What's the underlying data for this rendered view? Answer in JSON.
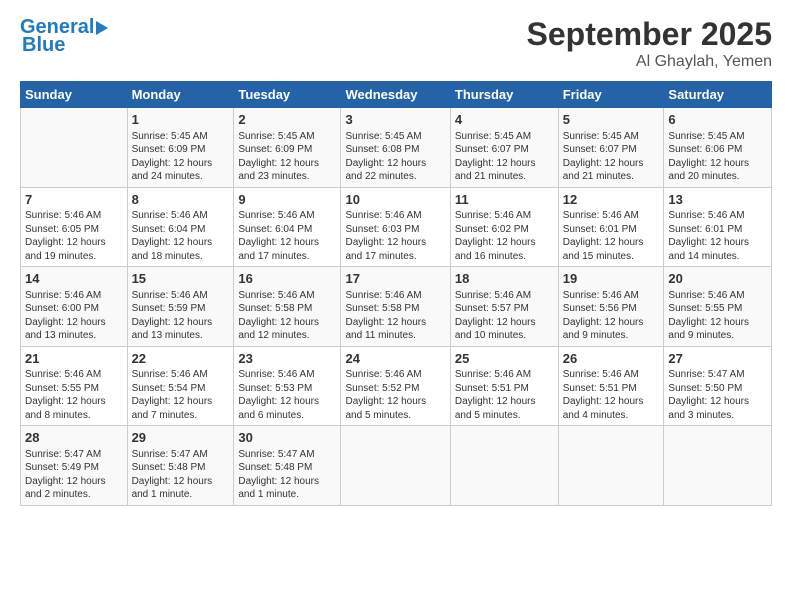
{
  "header": {
    "logo_line1": "General",
    "logo_line2": "Blue",
    "title": "September 2025",
    "location": "Al Ghaylah, Yemen"
  },
  "columns": [
    "Sunday",
    "Monday",
    "Tuesday",
    "Wednesday",
    "Thursday",
    "Friday",
    "Saturday"
  ],
  "weeks": [
    [
      {
        "day": "",
        "data": ""
      },
      {
        "day": "1",
        "data": "Sunrise: 5:45 AM\nSunset: 6:09 PM\nDaylight: 12 hours\nand 24 minutes."
      },
      {
        "day": "2",
        "data": "Sunrise: 5:45 AM\nSunset: 6:09 PM\nDaylight: 12 hours\nand 23 minutes."
      },
      {
        "day": "3",
        "data": "Sunrise: 5:45 AM\nSunset: 6:08 PM\nDaylight: 12 hours\nand 22 minutes."
      },
      {
        "day": "4",
        "data": "Sunrise: 5:45 AM\nSunset: 6:07 PM\nDaylight: 12 hours\nand 21 minutes."
      },
      {
        "day": "5",
        "data": "Sunrise: 5:45 AM\nSunset: 6:07 PM\nDaylight: 12 hours\nand 21 minutes."
      },
      {
        "day": "6",
        "data": "Sunrise: 5:45 AM\nSunset: 6:06 PM\nDaylight: 12 hours\nand 20 minutes."
      }
    ],
    [
      {
        "day": "7",
        "data": "Sunrise: 5:46 AM\nSunset: 6:05 PM\nDaylight: 12 hours\nand 19 minutes."
      },
      {
        "day": "8",
        "data": "Sunrise: 5:46 AM\nSunset: 6:04 PM\nDaylight: 12 hours\nand 18 minutes."
      },
      {
        "day": "9",
        "data": "Sunrise: 5:46 AM\nSunset: 6:04 PM\nDaylight: 12 hours\nand 17 minutes."
      },
      {
        "day": "10",
        "data": "Sunrise: 5:46 AM\nSunset: 6:03 PM\nDaylight: 12 hours\nand 17 minutes."
      },
      {
        "day": "11",
        "data": "Sunrise: 5:46 AM\nSunset: 6:02 PM\nDaylight: 12 hours\nand 16 minutes."
      },
      {
        "day": "12",
        "data": "Sunrise: 5:46 AM\nSunset: 6:01 PM\nDaylight: 12 hours\nand 15 minutes."
      },
      {
        "day": "13",
        "data": "Sunrise: 5:46 AM\nSunset: 6:01 PM\nDaylight: 12 hours\nand 14 minutes."
      }
    ],
    [
      {
        "day": "14",
        "data": "Sunrise: 5:46 AM\nSunset: 6:00 PM\nDaylight: 12 hours\nand 13 minutes."
      },
      {
        "day": "15",
        "data": "Sunrise: 5:46 AM\nSunset: 5:59 PM\nDaylight: 12 hours\nand 13 minutes."
      },
      {
        "day": "16",
        "data": "Sunrise: 5:46 AM\nSunset: 5:58 PM\nDaylight: 12 hours\nand 12 minutes."
      },
      {
        "day": "17",
        "data": "Sunrise: 5:46 AM\nSunset: 5:58 PM\nDaylight: 12 hours\nand 11 minutes."
      },
      {
        "day": "18",
        "data": "Sunrise: 5:46 AM\nSunset: 5:57 PM\nDaylight: 12 hours\nand 10 minutes."
      },
      {
        "day": "19",
        "data": "Sunrise: 5:46 AM\nSunset: 5:56 PM\nDaylight: 12 hours\nand 9 minutes."
      },
      {
        "day": "20",
        "data": "Sunrise: 5:46 AM\nSunset: 5:55 PM\nDaylight: 12 hours\nand 9 minutes."
      }
    ],
    [
      {
        "day": "21",
        "data": "Sunrise: 5:46 AM\nSunset: 5:55 PM\nDaylight: 12 hours\nand 8 minutes."
      },
      {
        "day": "22",
        "data": "Sunrise: 5:46 AM\nSunset: 5:54 PM\nDaylight: 12 hours\nand 7 minutes."
      },
      {
        "day": "23",
        "data": "Sunrise: 5:46 AM\nSunset: 5:53 PM\nDaylight: 12 hours\nand 6 minutes."
      },
      {
        "day": "24",
        "data": "Sunrise: 5:46 AM\nSunset: 5:52 PM\nDaylight: 12 hours\nand 5 minutes."
      },
      {
        "day": "25",
        "data": "Sunrise: 5:46 AM\nSunset: 5:51 PM\nDaylight: 12 hours\nand 5 minutes."
      },
      {
        "day": "26",
        "data": "Sunrise: 5:46 AM\nSunset: 5:51 PM\nDaylight: 12 hours\nand 4 minutes."
      },
      {
        "day": "27",
        "data": "Sunrise: 5:47 AM\nSunset: 5:50 PM\nDaylight: 12 hours\nand 3 minutes."
      }
    ],
    [
      {
        "day": "28",
        "data": "Sunrise: 5:47 AM\nSunset: 5:49 PM\nDaylight: 12 hours\nand 2 minutes."
      },
      {
        "day": "29",
        "data": "Sunrise: 5:47 AM\nSunset: 5:48 PM\nDaylight: 12 hours\nand 1 minute."
      },
      {
        "day": "30",
        "data": "Sunrise: 5:47 AM\nSunset: 5:48 PM\nDaylight: 12 hours\nand 1 minute."
      },
      {
        "day": "",
        "data": ""
      },
      {
        "day": "",
        "data": ""
      },
      {
        "day": "",
        "data": ""
      },
      {
        "day": "",
        "data": ""
      }
    ]
  ]
}
